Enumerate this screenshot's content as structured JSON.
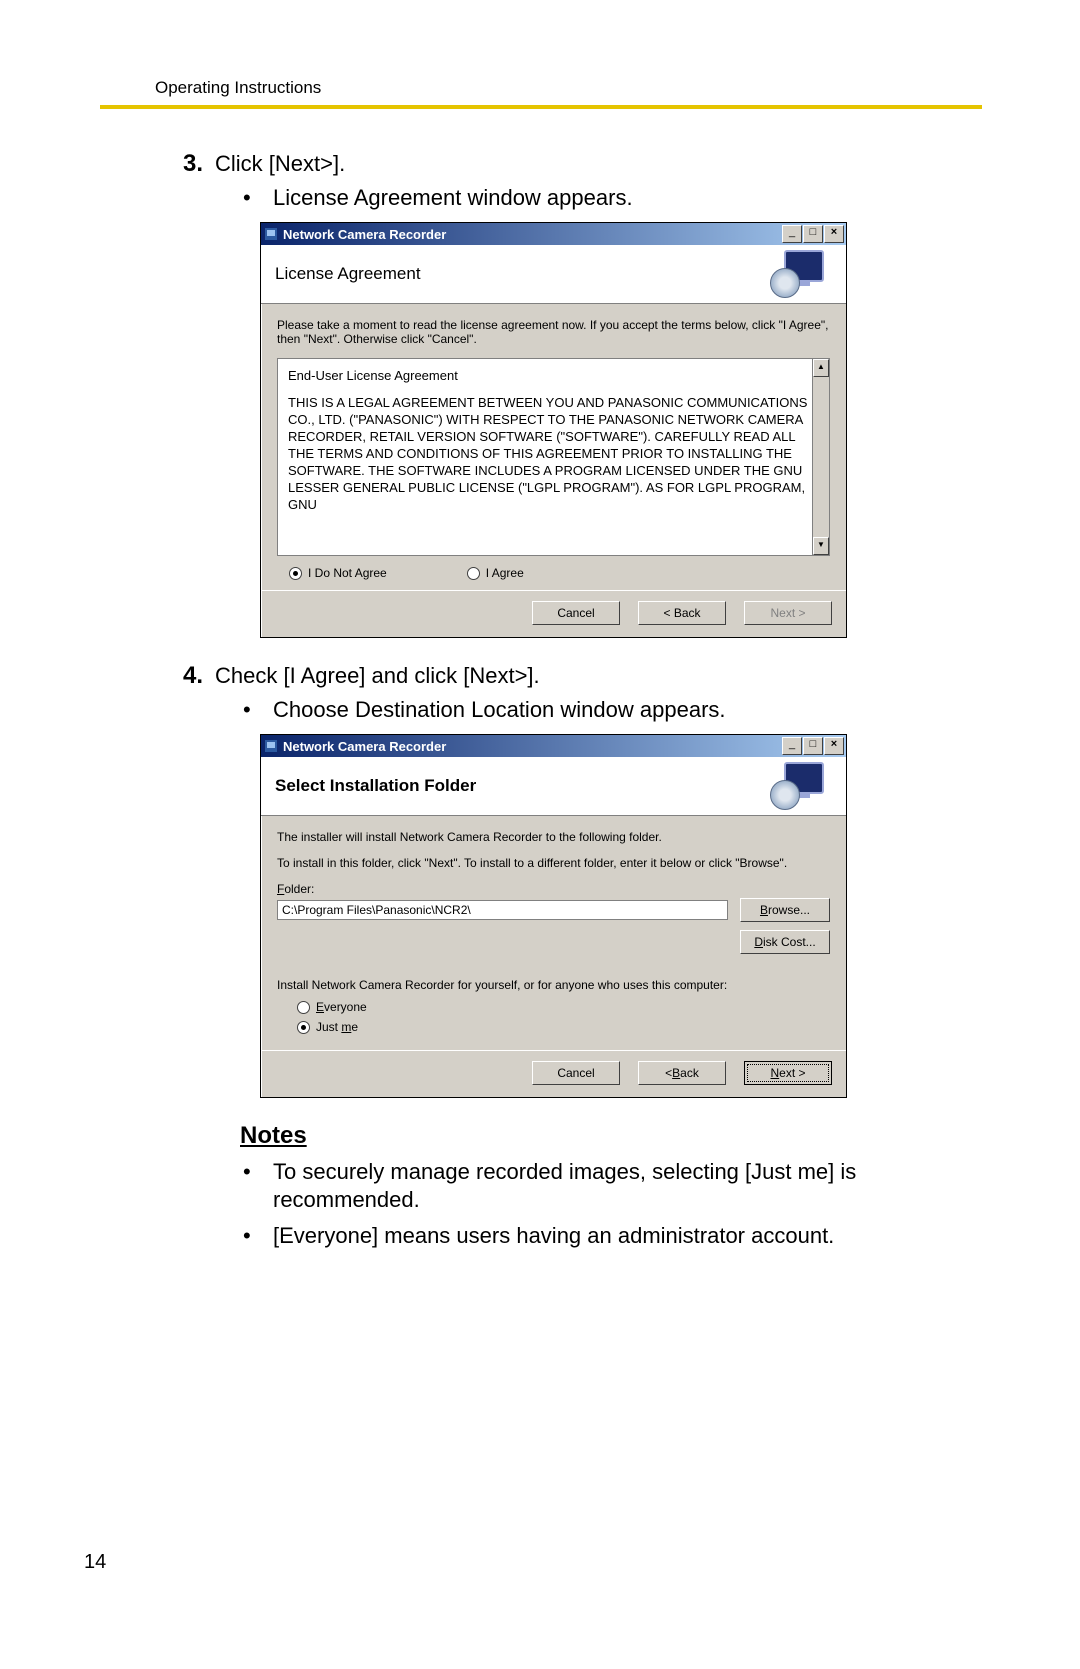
{
  "running_head": "Operating Instructions",
  "page_number": "14",
  "step3": {
    "num": "3.",
    "text": "Click [Next>].",
    "bullet": "License Agreement window appears."
  },
  "step4": {
    "num": "4.",
    "text": "Check [I Agree] and click [Next>].",
    "bullet": "Choose Destination Location window appears."
  },
  "notes": {
    "heading": "Notes",
    "b1": "To securely manage recorded images, selecting [Just me] is recommended.",
    "b2": "[Everyone] means users having an administrator account."
  },
  "win1": {
    "title": "Network Camera Recorder",
    "heading": "License Agreement",
    "instr": "Please take a moment to read the license agreement now. If you accept the terms below, click \"I Agree\", then \"Next\". Otherwise click \"Cancel\".",
    "eula_line1": "End-User License Agreement",
    "eula_body": "THIS IS A LEGAL AGREEMENT BETWEEN YOU AND PANASONIC COMMUNICATIONS CO., LTD. (\"PANASONIC\") WITH RESPECT TO THE PANASONIC NETWORK CAMERA RECORDER, RETAIL VERSION SOFTWARE (\"SOFTWARE\"). CAREFULLY READ ALL THE TERMS AND CONDITIONS OF THIS AGREEMENT PRIOR TO INSTALLING THE SOFTWARE. THE SOFTWARE INCLUDES A PROGRAM LICENSED UNDER THE GNU LESSER GENERAL PUBLIC LICENSE (\"LGPL PROGRAM\"). AS FOR LGPL PROGRAM, GNU",
    "r_disagree": "I Do Not Agree",
    "r_agree": "I Agree",
    "btn_cancel": "Cancel",
    "btn_back": "< Back",
    "btn_next": "Next >"
  },
  "win2": {
    "title": "Network Camera Recorder",
    "heading": "Select Installation Folder",
    "instr1": "The installer will install Network Camera Recorder to the following folder.",
    "instr2": "To install in this folder, click \"Next\". To install to a different folder, enter it below or click \"Browse\".",
    "folder_label": "Folder:",
    "folder_value": "C:\\Program Files\\Panasonic\\NCR2\\",
    "btn_browse": "Browse...",
    "btn_diskcost": "Disk Cost...",
    "install_for": "Install Network Camera Recorder for yourself, or for anyone who uses this computer:",
    "r_everyone": "Everyone",
    "r_justme": "Just me",
    "btn_cancel": "Cancel",
    "btn_back": "< Back",
    "btn_next": "Next >"
  }
}
